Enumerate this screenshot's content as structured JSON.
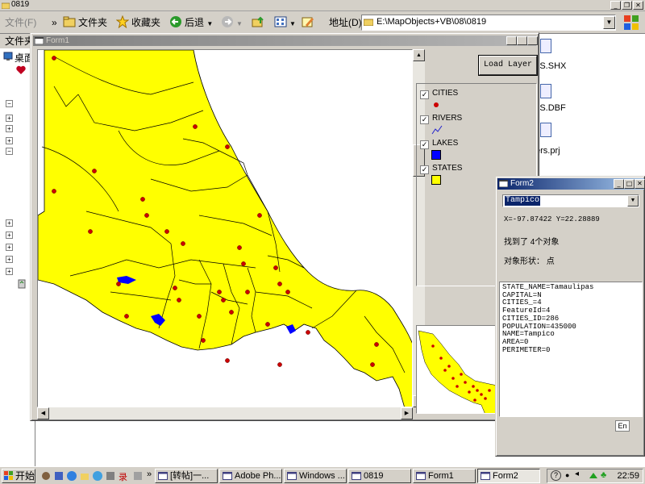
{
  "explorer": {
    "title": "0819",
    "menu_file": "文件(F)",
    "chevron": "»",
    "folders_label": "文件夹",
    "favorites_label": "收藏夹",
    "back_label": "后退",
    "address_label": "地址(D)",
    "address_value": "E:\\MapObjects+VB\\08\\0819",
    "left_pane_header": "文件夹",
    "desktop_label": "桌面",
    "files": [
      "ES.SHX",
      "ES.DBF",
      "ers.prj"
    ]
  },
  "form1": {
    "title": "Form1",
    "load_button": "Load Layer",
    "legend": [
      {
        "name": "CITIES",
        "checked": true,
        "symbol": "point",
        "color": "#cc0000"
      },
      {
        "name": "RIVERS",
        "checked": true,
        "symbol": "line",
        "color": "#2222cc"
      },
      {
        "name": "LAKES",
        "checked": true,
        "symbol": "fill",
        "color": "#0000ff"
      },
      {
        "name": "STATES",
        "checked": true,
        "symbol": "fill",
        "color": "#ffff00"
      }
    ]
  },
  "form2": {
    "title": "Form2",
    "combo_value": "Tampico",
    "coords": "X=-97.87422  Y=22.28889",
    "found_text": "找到了 4个对象",
    "shape_text": "对象形状：  点",
    "attributes": [
      "STATE_NAME=Tamaulipas",
      "CAPITAL=N",
      "CITIES_=4",
      "FeatureId=4",
      "CITIES_ID=286",
      "POPULATION=435000",
      "NAME=Tampico",
      "AREA=0",
      "PERIMETER=0"
    ],
    "lang": "En"
  },
  "taskbar": {
    "start": "开始",
    "tasks": [
      {
        "label": "[转帖]一...",
        "active": false
      },
      {
        "label": "Adobe Ph...",
        "active": false
      },
      {
        "label": "Windows ...",
        "active": false
      },
      {
        "label": "0819",
        "active": false
      },
      {
        "label": "Form1",
        "active": false
      },
      {
        "label": "Form2",
        "active": true
      }
    ],
    "clock": "22:59"
  },
  "colors": {
    "state_fill": "#ffff00",
    "city": "#cc0000",
    "lake": "#0000ff",
    "titlebar_active": "#0a246a",
    "face": "#d4d0c8"
  }
}
